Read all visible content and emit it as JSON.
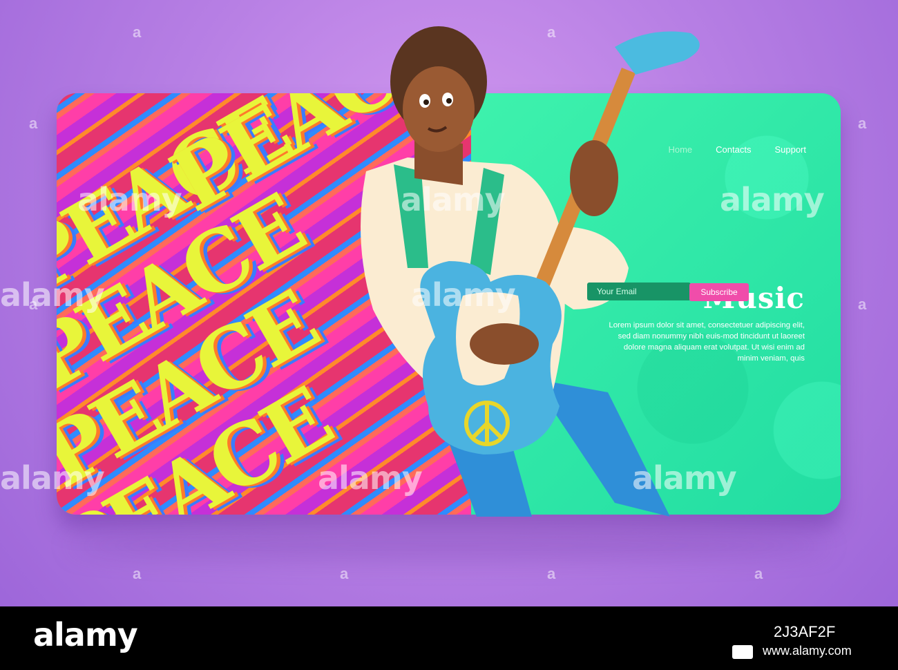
{
  "nav": {
    "items": [
      {
        "label": "Home",
        "active": true
      },
      {
        "label": "Contacts",
        "active": false
      },
      {
        "label": "Support",
        "active": false
      }
    ]
  },
  "hero": {
    "title": "Music",
    "description": "Lorem ipsum dolor sit amet, consectetuer adipiscing elit, sed diam nonummy nibh euis-mod tincidunt ut laoreet dolore magna aliquam erat volutpat. Ut wisi enim ad minim veniam, quis"
  },
  "form": {
    "email_placeholder": "Your Email",
    "subscribe_label": "Subscribe"
  },
  "art": {
    "word": "PEACE"
  },
  "watermark": {
    "text": "alamy",
    "tile_glyph": "a"
  },
  "footer": {
    "logo": "alamy",
    "image_id": "2J3AF2F",
    "url": "www.alamy.com"
  },
  "colors": {
    "background": "#b77fe4",
    "card_green": "#2ee9a6",
    "subscribe": "#f04daa",
    "email_bg": "#189466"
  }
}
